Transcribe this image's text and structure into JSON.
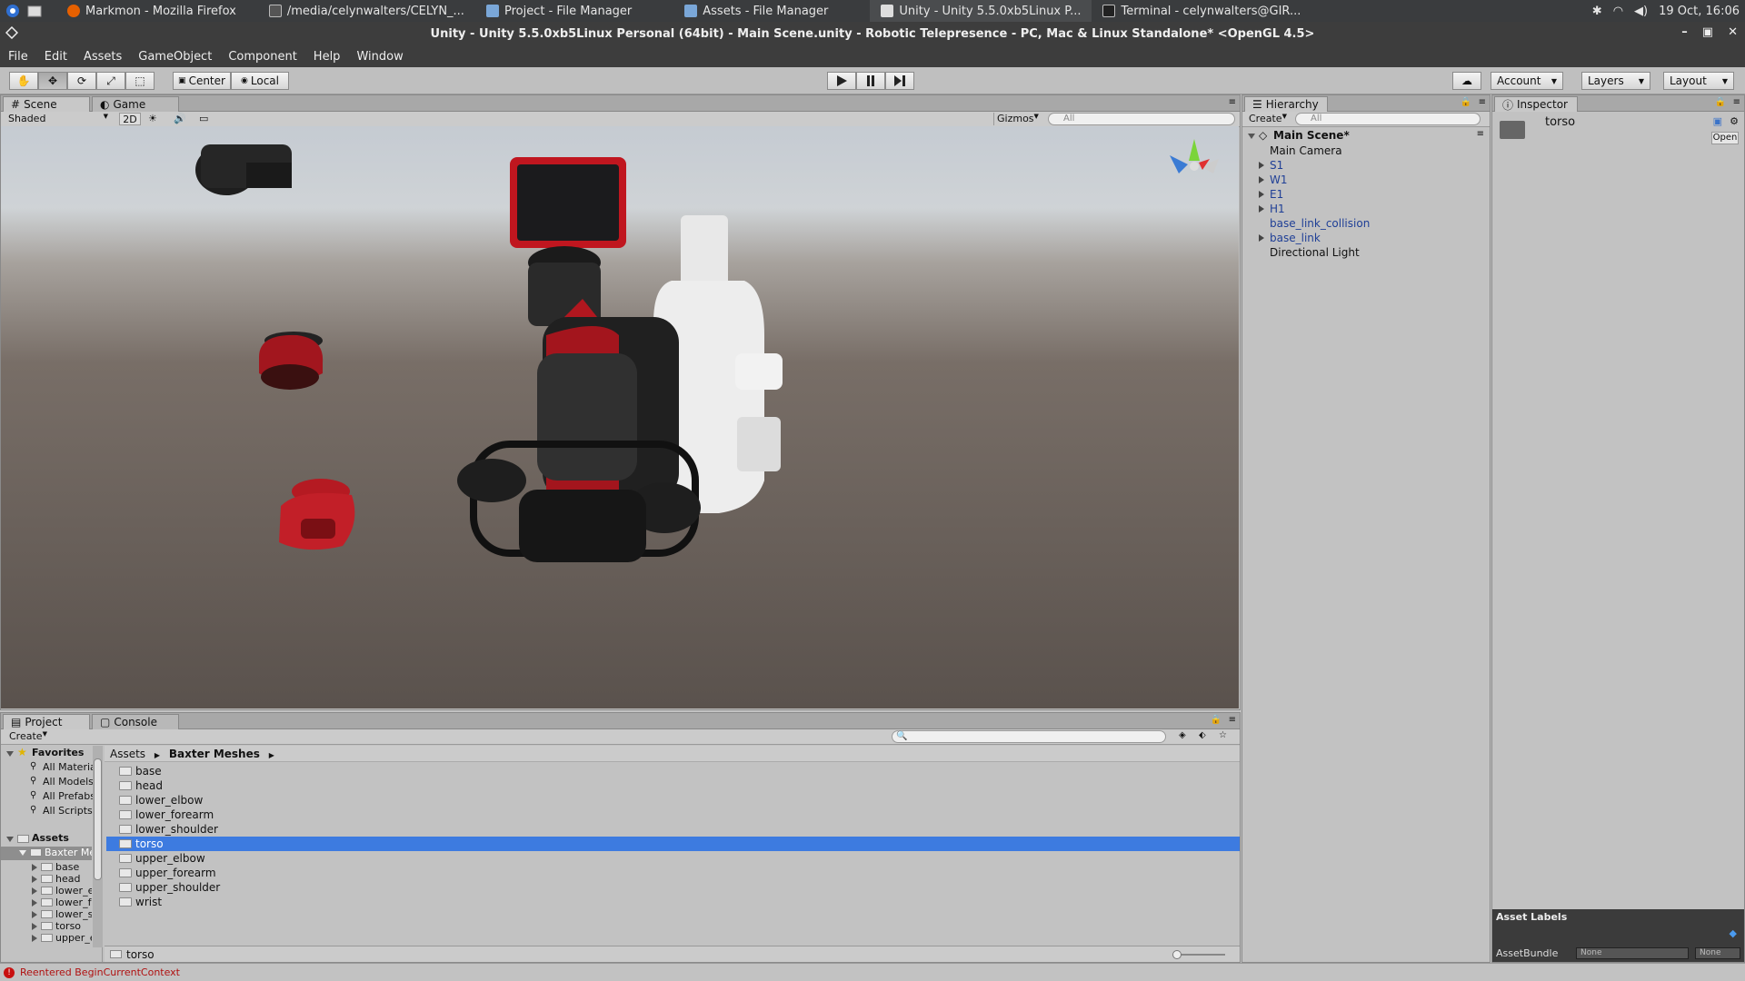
{
  "taskbar": {
    "tasks": [
      {
        "label": "Markmon - Mozilla Firefox"
      },
      {
        "label": "/media/celynwalters/CELYN_..."
      },
      {
        "label": "Project - File Manager"
      },
      {
        "label": "Assets - File Manager"
      },
      {
        "label": "Unity - Unity 5.5.0xb5Linux P..."
      },
      {
        "label": "Terminal - celynwalters@GIR..."
      }
    ],
    "clock": "19 Oct, 16:06"
  },
  "window": {
    "title": "Unity - Unity 5.5.0xb5Linux Personal (64bit) - Main Scene.unity - Robotic Telepresence - PC, Mac & Linux Standalone* <OpenGL 4.5>"
  },
  "menu": [
    "File",
    "Edit",
    "Assets",
    "GameObject",
    "Component",
    "Help",
    "Window"
  ],
  "toolbar": {
    "pivot": "Center",
    "space": "Local",
    "account": "Account",
    "layers": "Layers",
    "layout": "Layout"
  },
  "scene": {
    "tabs": [
      "Scene",
      "Game"
    ],
    "shading": "Shaded",
    "mode2d": "2D",
    "gizmos": "Gizmos",
    "search_placeholder": "All"
  },
  "hierarchy": {
    "tab": "Hierarchy",
    "create": "Create",
    "search_placeholder": "All",
    "scene_name": "Main Scene*",
    "items": [
      {
        "label": "Main Camera",
        "expandable": false,
        "prefab": false
      },
      {
        "label": "S1",
        "expandable": true,
        "prefab": true
      },
      {
        "label": "W1",
        "expandable": true,
        "prefab": true
      },
      {
        "label": "E1",
        "expandable": true,
        "prefab": true
      },
      {
        "label": "H1",
        "expandable": true,
        "prefab": true
      },
      {
        "label": "base_link_collision",
        "expandable": false,
        "prefab": true
      },
      {
        "label": "base_link",
        "expandable": true,
        "prefab": true
      },
      {
        "label": "Directional Light",
        "expandable": false,
        "prefab": false
      }
    ]
  },
  "inspector": {
    "tab": "Inspector",
    "object_name": "torso",
    "open_button": "Open",
    "asset_labels": "Asset Labels",
    "asset_bundle_label": "AssetBundle",
    "bundle_value": "None",
    "variant_value": "None"
  },
  "project": {
    "tabs": [
      "Project",
      "Console"
    ],
    "create": "Create",
    "favorites_label": "Favorites",
    "favorites": [
      "All Materials",
      "All Models",
      "All Prefabs",
      "All Scripts"
    ],
    "assets_label": "Assets",
    "tree_root": "Baxter Meshes",
    "tree_children": [
      "base",
      "head",
      "lower_elbow",
      "lower_forearm",
      "lower_shoulder",
      "torso",
      "upper_elbow"
    ],
    "breadcrumb": [
      "Assets",
      "Baxter Meshes"
    ],
    "folders": [
      "base",
      "head",
      "lower_elbow",
      "lower_forearm",
      "lower_shoulder",
      "torso",
      "upper_elbow",
      "upper_forearm",
      "upper_shoulder",
      "wrist"
    ],
    "selected_folder": "torso",
    "footer_path": "torso"
  },
  "status": {
    "message": "Reentered BeginCurrentContext"
  }
}
